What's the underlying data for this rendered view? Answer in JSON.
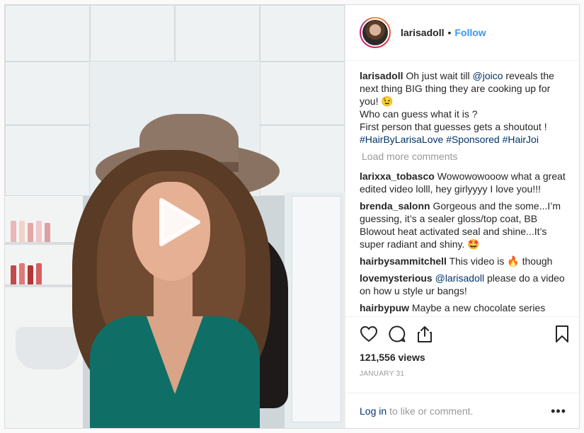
{
  "post": {
    "username": "larisadoll",
    "follow_label": "Follow",
    "caption_prefix": "Oh just wait till",
    "caption_mention": "@joico",
    "caption_middle": "reveals the next thing BIG thing they are cooking up for you!",
    "caption_emoji": "😉",
    "caption_line2": "Who can guess what it is ?",
    "caption_line3": "First person that guesses gets a shoutout !",
    "hashtags": [
      "#HairByLarisaLove",
      "#Sponsored",
      "#HairJoi"
    ],
    "load_more": "Load more comments",
    "views": "121,556 views",
    "date": "JANUARY 31"
  },
  "comments": [
    {
      "user": "larixxa_tobasco",
      "text": "Wowowowooow what a great edited video lolll, hey girlyyyy I love you!!!"
    },
    {
      "user": "brenda_salonn",
      "text": "Gorgeous and the some...I’m guessing, it’s a sealer gloss/top coat, BB Blowout heat activated seal and shine...It’s super radiant and shiny.",
      "emoji": "🤩"
    },
    {
      "user": "hairbysammitchell",
      "text_before": "This video is",
      "emoji": "🔥",
      "text_after": "though"
    },
    {
      "user": "lovemysterious",
      "mention": "@larisadoll",
      "text": "please do a video on how u style ur bangs!"
    },
    {
      "user": "hairbypuw",
      "text": "Maybe a new chocolate series"
    }
  ],
  "footer": {
    "login_link": "Log in",
    "login_text": "to like or comment.",
    "more_label": "•••"
  },
  "icons": {
    "play": "play-icon",
    "like": "heart-icon",
    "comment": "comment-bubble-icon",
    "share": "share-icon",
    "save": "bookmark-icon"
  },
  "colors": {
    "follow": "#3897f0",
    "link": "#003569",
    "muted": "#999999"
  }
}
